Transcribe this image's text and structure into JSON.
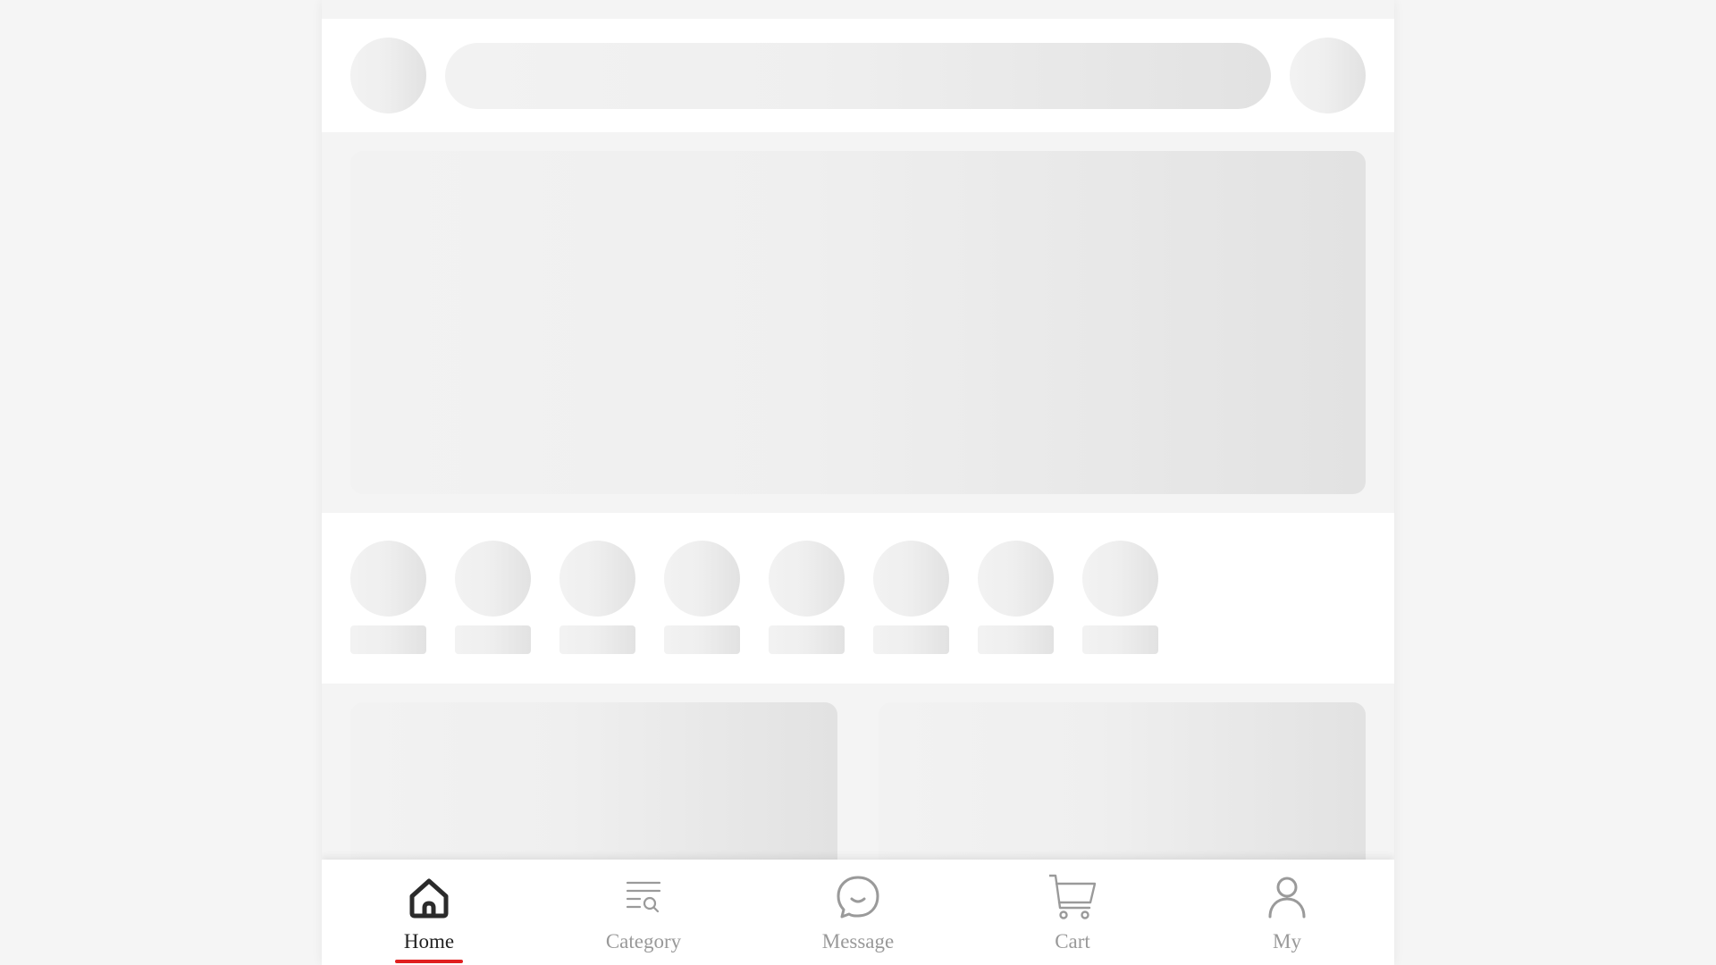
{
  "tabbar": {
    "active": "home",
    "accent_color": "#e02020",
    "items": [
      {
        "id": "home",
        "label": "Home",
        "icon": "home-icon"
      },
      {
        "id": "category",
        "label": "Category",
        "icon": "category-search-icon"
      },
      {
        "id": "message",
        "label": "Message",
        "icon": "message-icon"
      },
      {
        "id": "cart",
        "label": "Cart",
        "icon": "cart-icon"
      },
      {
        "id": "my",
        "label": "My",
        "icon": "user-icon"
      }
    ]
  },
  "skeleton": {
    "shortcut_count": 8,
    "card_count": 2
  }
}
